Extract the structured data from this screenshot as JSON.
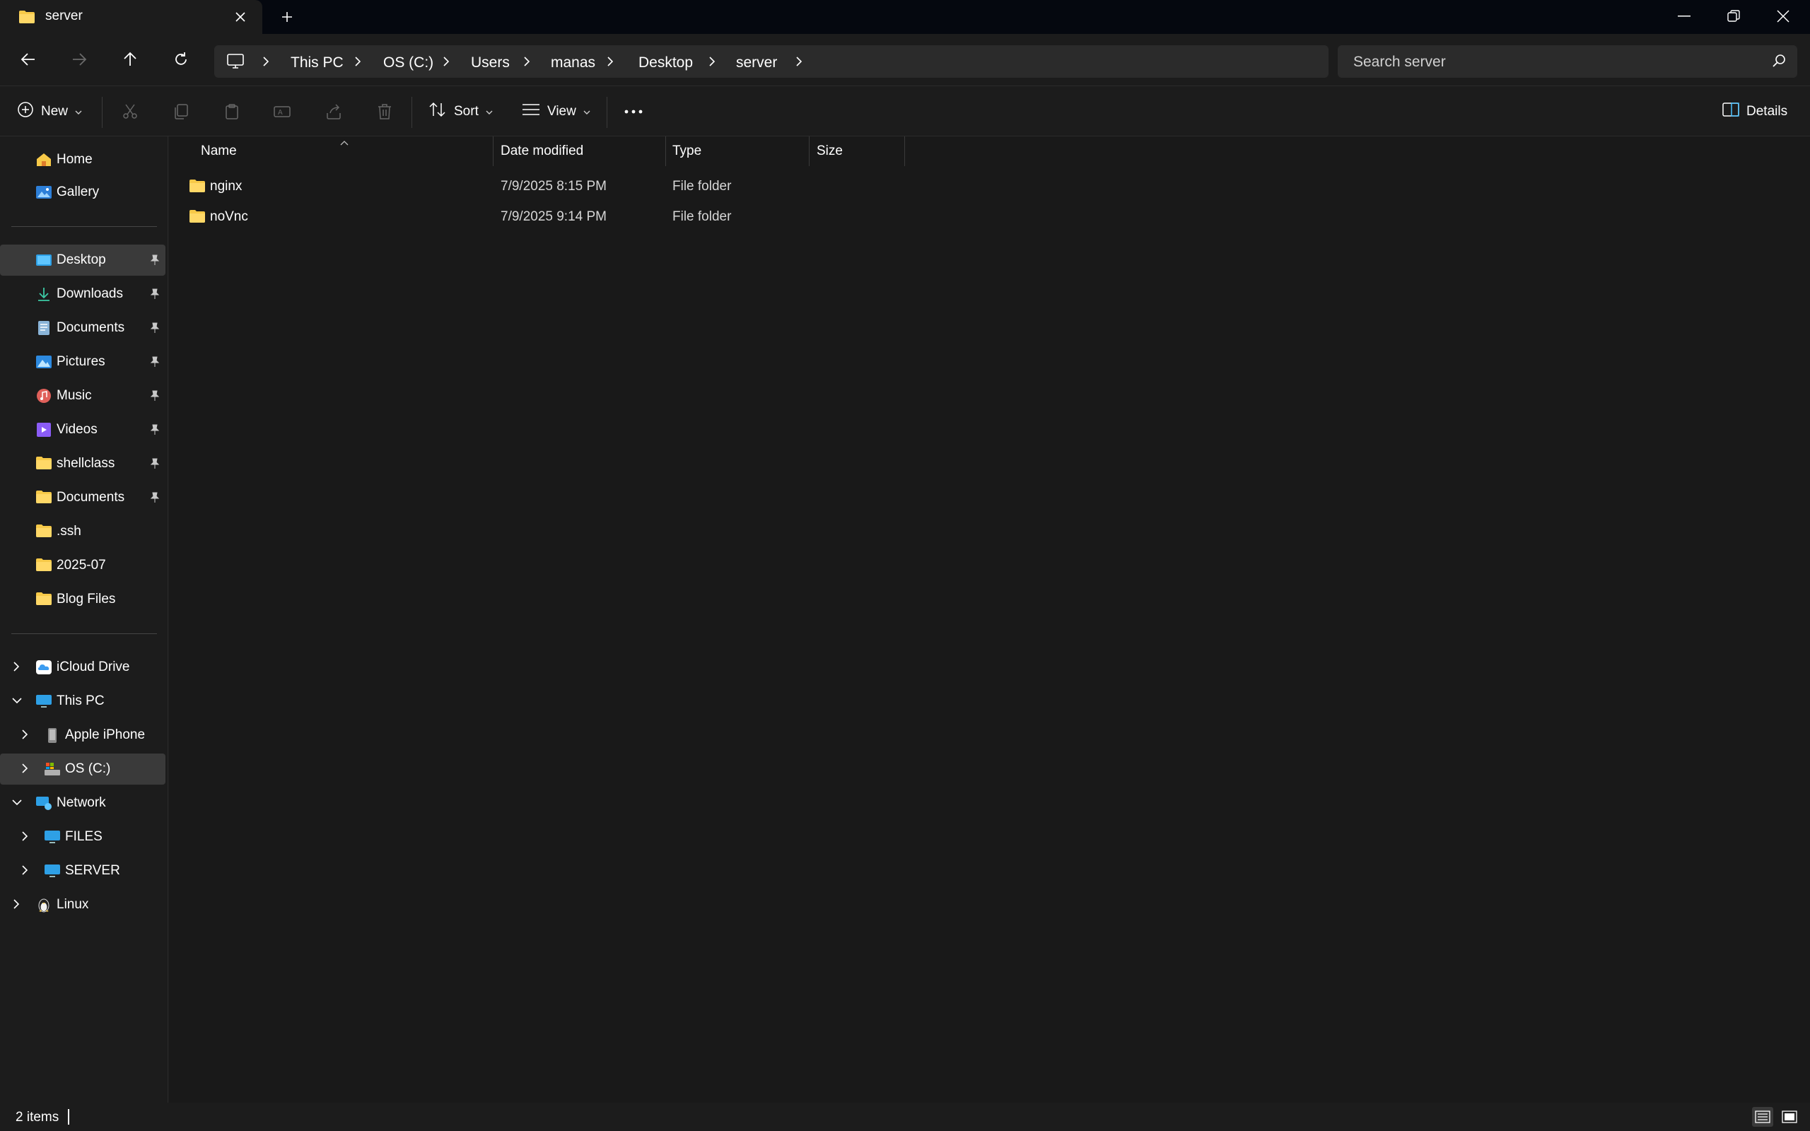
{
  "window": {
    "tab_title": "server",
    "new_tab_symbol": "+"
  },
  "address": {
    "crumbs": [
      "This PC",
      "OS (C:)",
      "Users",
      "manas",
      "Desktop",
      "server"
    ]
  },
  "search": {
    "placeholder": "Search server"
  },
  "toolbar": {
    "new_label": "New",
    "sort_label": "Sort",
    "view_label": "View",
    "details_label": "Details"
  },
  "sidebar": {
    "quick": [
      {
        "label": "Home",
        "icon": "home-icon"
      },
      {
        "label": "Gallery",
        "icon": "gallery-icon"
      }
    ],
    "pinned": [
      {
        "label": "Desktop",
        "icon": "desktop-icon",
        "pinned": true,
        "selected": true
      },
      {
        "label": "Downloads",
        "icon": "downloads-icon",
        "pinned": true
      },
      {
        "label": "Documents",
        "icon": "documents-icon",
        "pinned": true
      },
      {
        "label": "Pictures",
        "icon": "pictures-icon",
        "pinned": true
      },
      {
        "label": "Music",
        "icon": "music-icon",
        "pinned": true
      },
      {
        "label": "Videos",
        "icon": "videos-icon",
        "pinned": true
      },
      {
        "label": "shellclass",
        "icon": "folder-icon",
        "pinned": true
      },
      {
        "label": "Documents",
        "icon": "folder-icon",
        "pinned": true
      },
      {
        "label": ".ssh",
        "icon": "folder-icon"
      },
      {
        "label": "2025-07",
        "icon": "folder-icon"
      },
      {
        "label": "Blog Files",
        "icon": "folder-icon"
      }
    ],
    "tree": [
      {
        "label": "iCloud Drive",
        "icon": "icloud-icon",
        "expanded": false
      },
      {
        "label": "This PC",
        "icon": "pc-icon",
        "expanded": true
      },
      {
        "label": "Apple iPhone",
        "icon": "phone-icon",
        "expanded": false
      },
      {
        "label": "OS (C:)",
        "icon": "drive-icon",
        "expanded": false,
        "selected": true
      },
      {
        "label": "Network",
        "icon": "network-icon",
        "expanded": true
      },
      {
        "label": "FILES",
        "icon": "computer-icon",
        "expanded": false
      },
      {
        "label": "SERVER",
        "icon": "computer-icon",
        "expanded": false
      },
      {
        "label": "Linux",
        "icon": "linux-icon",
        "expanded": false
      }
    ]
  },
  "list": {
    "columns": {
      "name": "Name",
      "date": "Date modified",
      "type": "Type",
      "size": "Size"
    },
    "rows": [
      {
        "name": "nginx",
        "date": "7/9/2025 8:15 PM",
        "type": "File folder",
        "size": ""
      },
      {
        "name": "noVnc",
        "date": "7/9/2025 9:14 PM",
        "type": "File folder",
        "size": ""
      }
    ]
  },
  "status": {
    "items": "2 items"
  },
  "colors": {
    "folder": "#f7c948",
    "accent": "#4cc2ff",
    "background": "#1c1c1c"
  }
}
